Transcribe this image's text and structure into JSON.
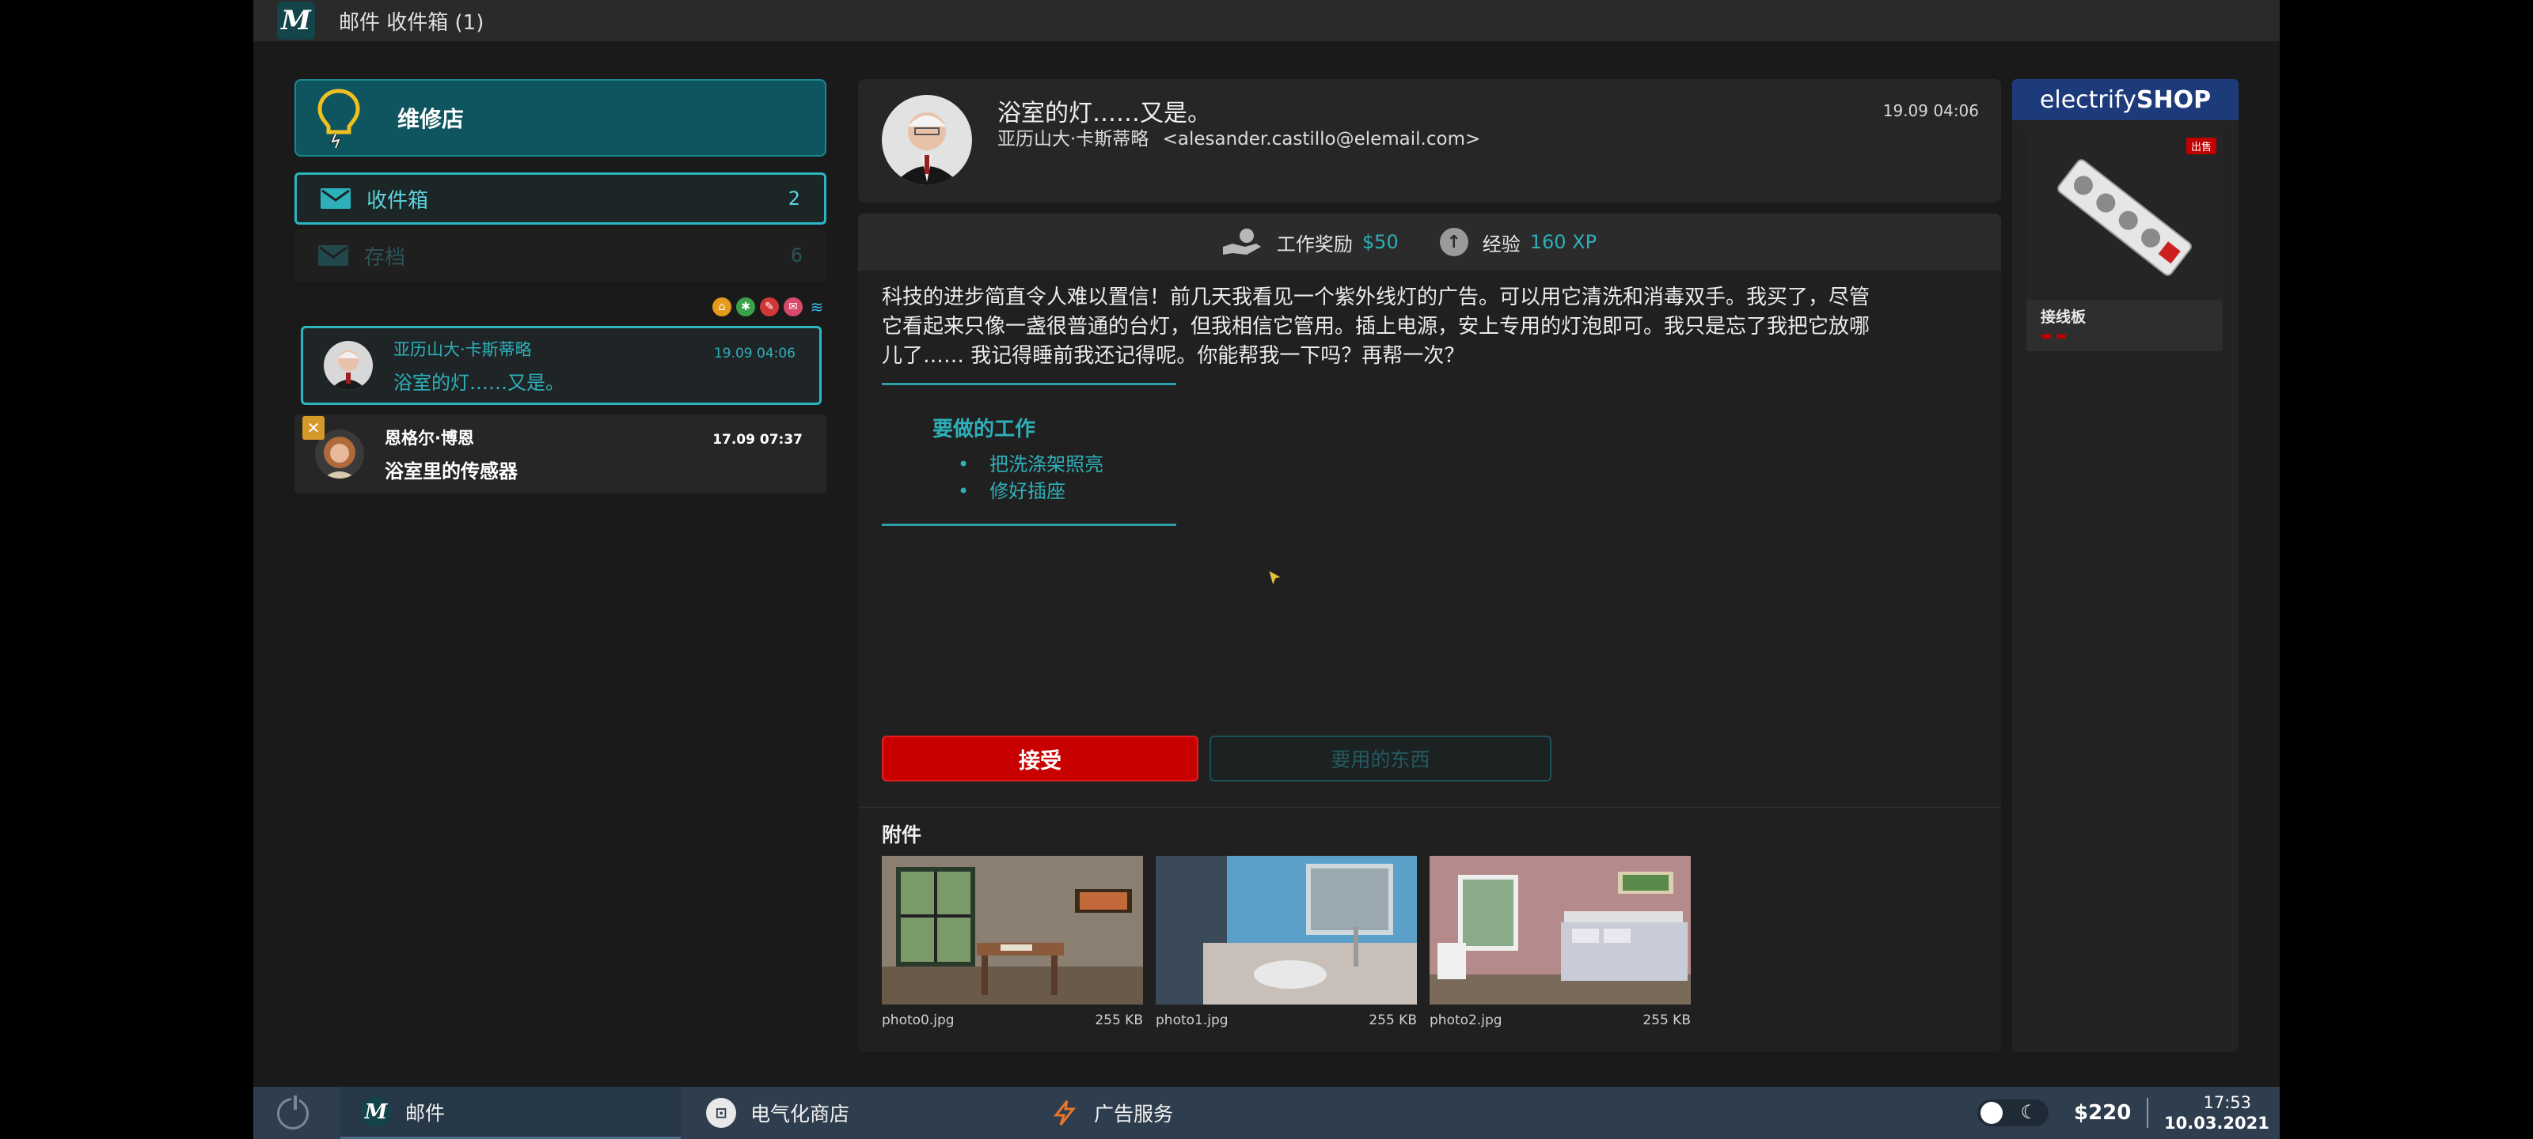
{
  "window": {
    "title": "邮件 收件箱 (1)"
  },
  "sidebar": {
    "shop_label": "维修店",
    "folders": [
      {
        "name": "收件箱",
        "count": "2"
      },
      {
        "name": "存档",
        "count": "6"
      }
    ],
    "messages": [
      {
        "from": "亚历山大·卡斯蒂略",
        "subject": "浴室的灯……又是。",
        "time": "19.09 04:06",
        "state": "selected"
      },
      {
        "from": "恩格尔·博恩",
        "subject": "浴室里的传感器",
        "time": "17.09 07:37",
        "state": "unread"
      }
    ]
  },
  "email": {
    "subject": "浴室的灯……又是。",
    "sender_name": "亚历山大·卡斯蒂略",
    "sender_email": "<alesander.castillo@elemail.com>",
    "date": "19.09 04:06",
    "reward_label": "工作奖励",
    "reward_value": "$50",
    "xp_label": "经验",
    "xp_value": "160 XP",
    "body_lines": [
      "科技的进步简直令人难以置信！前几天我看见一个紫外线灯的广告。可以用它清洗和消毒双手。我买了，尽管",
      "它看起来只像一盏很普通的台灯，但我相信它管用。插上电源，安上专用的灯泡即可。我只是忘了我把它放哪",
      "儿了…… 我记得睡前我还记得呢。你能帮我一下吗？再帮一次？"
    ],
    "todo_title": "要做的工作",
    "todo": [
      "把洗涤架照亮",
      "修好插座"
    ],
    "accept_label": "接受",
    "items_label": "要用的东西",
    "attachments_title": "附件",
    "attachments": [
      {
        "name": "photo0.jpg",
        "size": "255 KB"
      },
      {
        "name": "photo1.jpg",
        "size": "255 KB"
      },
      {
        "name": "photo2.jpg",
        "size": "255 KB"
      }
    ]
  },
  "shop": {
    "logo_regular": "electrify",
    "logo_bold": "SHOP",
    "sale_tag": "出售",
    "item_name": "接线板"
  },
  "taskbar": {
    "apps": [
      {
        "label": "邮件"
      },
      {
        "label": "电气化商店"
      },
      {
        "label": "广告服务"
      }
    ],
    "money": "$220",
    "time": "17:53",
    "date": "10.03.2021"
  },
  "colors": {
    "accent_teal": "#2eb0ba",
    "accept_red": "#c80000",
    "shop_blue": "#1d3a7a",
    "taskbar": "#2f3e4e"
  }
}
